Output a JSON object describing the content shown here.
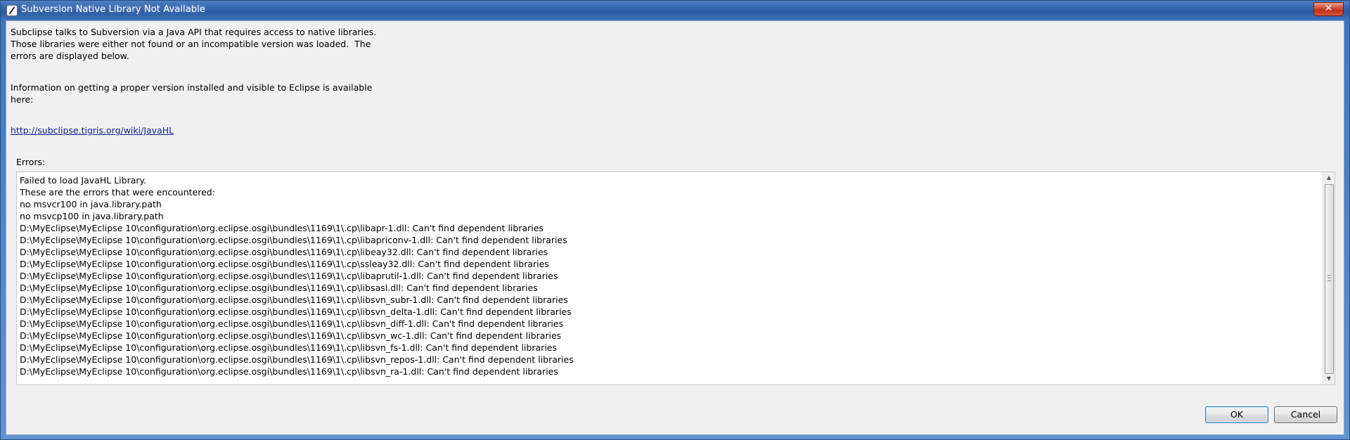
{
  "window": {
    "title": "Subversion Native Library Not Available",
    "close_label": "✕"
  },
  "message": {
    "line1": "Subclipse talks to Subversion via a Java API that requires access to native libraries.",
    "line2": "Those libraries were either not found or an incompatible version was loaded.  The",
    "line3": "errors are displayed below.",
    "line4": "Information on getting a proper version installed and visible to Eclipse is available",
    "line5": "here:"
  },
  "link": "http://subclipse.tigris.org/wiki/JavaHL",
  "errors": {
    "label": "Errors:",
    "lines": [
      "Failed to load JavaHL Library.",
      "These are the errors that were encountered:",
      "no msvcr100 in java.library.path",
      "no msvcp100 in java.library.path",
      "D:\\MyEclipse\\MyEclipse 10\\configuration\\org.eclipse.osgi\\bundles\\1169\\1\\.cp\\libapr-1.dll: Can't find dependent libraries",
      "D:\\MyEclipse\\MyEclipse 10\\configuration\\org.eclipse.osgi\\bundles\\1169\\1\\.cp\\libapriconv-1.dll: Can't find dependent libraries",
      "D:\\MyEclipse\\MyEclipse 10\\configuration\\org.eclipse.osgi\\bundles\\1169\\1\\.cp\\libeay32.dll: Can't find dependent libraries",
      "D:\\MyEclipse\\MyEclipse 10\\configuration\\org.eclipse.osgi\\bundles\\1169\\1\\.cp\\ssleay32.dll: Can't find dependent libraries",
      "D:\\MyEclipse\\MyEclipse 10\\configuration\\org.eclipse.osgi\\bundles\\1169\\1\\.cp\\libaprutil-1.dll: Can't find dependent libraries",
      "D:\\MyEclipse\\MyEclipse 10\\configuration\\org.eclipse.osgi\\bundles\\1169\\1\\.cp\\libsasl.dll: Can't find dependent libraries",
      "D:\\MyEclipse\\MyEclipse 10\\configuration\\org.eclipse.osgi\\bundles\\1169\\1\\.cp\\libsvn_subr-1.dll: Can't find dependent libraries",
      "D:\\MyEclipse\\MyEclipse 10\\configuration\\org.eclipse.osgi\\bundles\\1169\\1\\.cp\\libsvn_delta-1.dll: Can't find dependent libraries",
      "D:\\MyEclipse\\MyEclipse 10\\configuration\\org.eclipse.osgi\\bundles\\1169\\1\\.cp\\libsvn_diff-1.dll: Can't find dependent libraries",
      "D:\\MyEclipse\\MyEclipse 10\\configuration\\org.eclipse.osgi\\bundles\\1169\\1\\.cp\\libsvn_wc-1.dll: Can't find dependent libraries",
      "D:\\MyEclipse\\MyEclipse 10\\configuration\\org.eclipse.osgi\\bundles\\1169\\1\\.cp\\libsvn_fs-1.dll: Can't find dependent libraries",
      "D:\\MyEclipse\\MyEclipse 10\\configuration\\org.eclipse.osgi\\bundles\\1169\\1\\.cp\\libsvn_repos-1.dll: Can't find dependent libraries",
      "D:\\MyEclipse\\MyEclipse 10\\configuration\\org.eclipse.osgi\\bundles\\1169\\1\\.cp\\libsvn_ra-1.dll: Can't find dependent libraries"
    ]
  },
  "buttons": {
    "ok": "OK",
    "cancel": "Cancel"
  }
}
